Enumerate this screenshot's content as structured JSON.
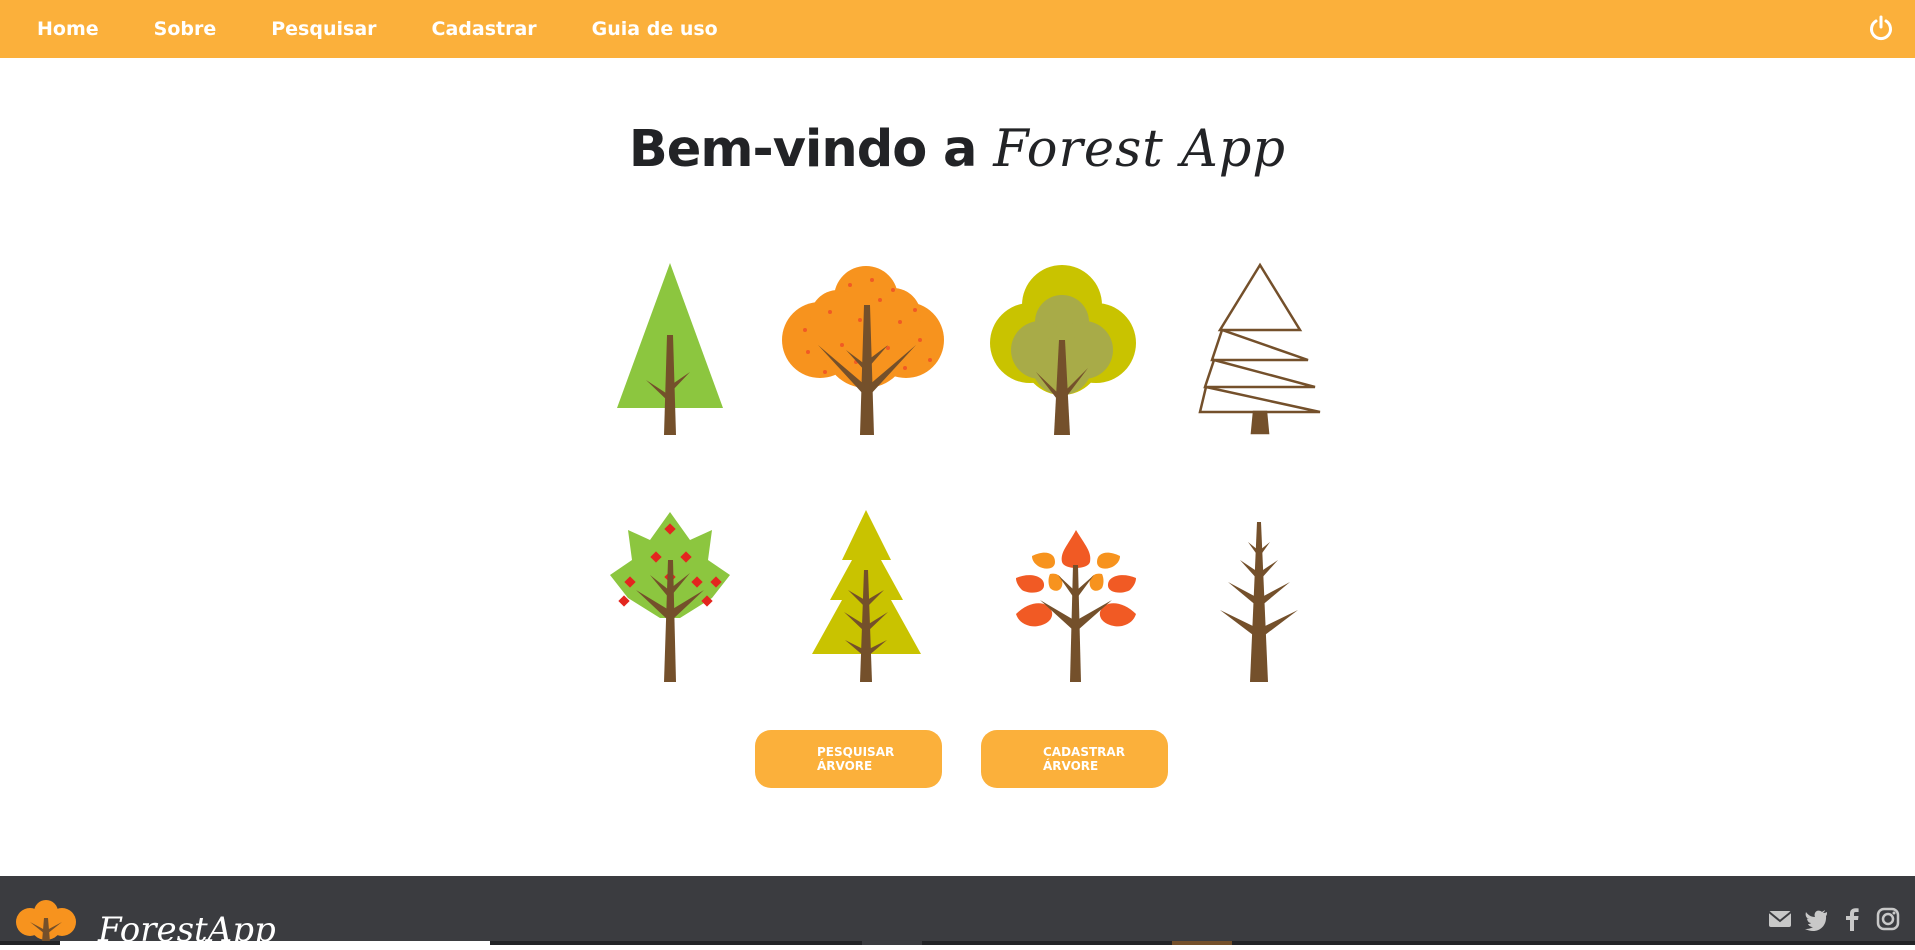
{
  "nav": {
    "items": [
      "Home",
      "Sobre",
      "Pesquisar",
      "Cadastrar",
      "Guia de uso"
    ],
    "power_icon": "power-icon"
  },
  "hero": {
    "title_part1": "Bem-vindo a ",
    "title_part2": "Forest App"
  },
  "actions": {
    "search_label": "PESQUISAR ÁRVORE",
    "register_label": "CADASTRAR ÁRVORE"
  },
  "footer": {
    "brand": "ForestApp",
    "social": [
      "envelope-icon",
      "twitter-icon",
      "facebook-icon",
      "instagram-icon"
    ]
  },
  "colors": {
    "accent": "#fbb03b",
    "footer": "#3b3c40",
    "trunk": "#74502b",
    "green": "#8cc63f",
    "orange": "#f7931e",
    "olive": "#c9c300",
    "red": "#f15a24"
  }
}
